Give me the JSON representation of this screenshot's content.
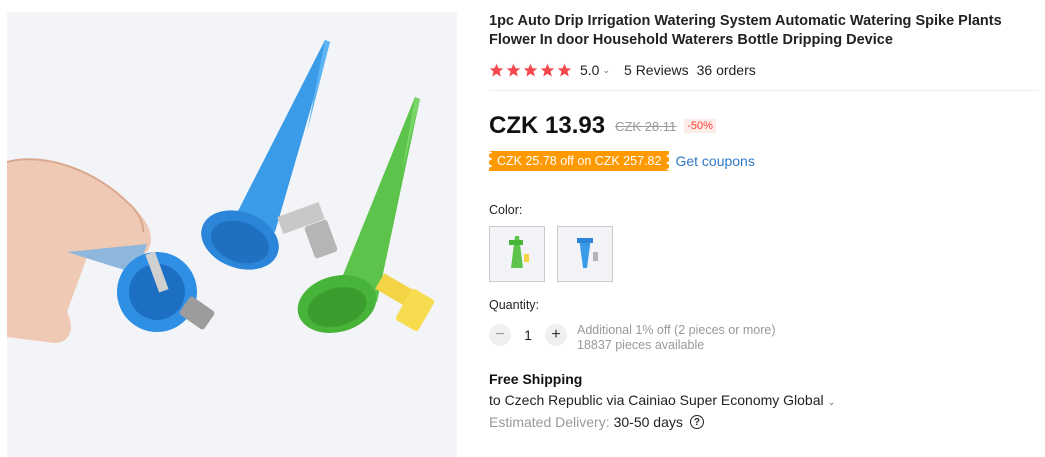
{
  "product": {
    "title": "1pc Auto Drip Irrigation Watering System Automatic Watering Spike Plants Flower In door Household Waterers Bottle Dripping Device",
    "rating": {
      "stars": 5,
      "score": "5.0",
      "reviews": "5 Reviews",
      "orders": "36 orders"
    },
    "price": {
      "current": "CZK 13.93",
      "original": "CZK 28.11",
      "discount": "-50%"
    },
    "coupon": {
      "text": "CZK 25.78 off on CZK 257.82",
      "link": "Get coupons"
    },
    "color": {
      "label": "Color:",
      "options": [
        "green-spike",
        "blue-spike"
      ]
    },
    "quantity": {
      "label": "Quantity:",
      "value": "1",
      "minus": "−",
      "plus": "+",
      "additional": "Additional 1% off (2 pieces or more)",
      "available": "18837 pieces available"
    },
    "shipping": {
      "title": "Free Shipping",
      "to": "to Czech Republic via Cainiao Super Economy Global",
      "delivery_label": "Estimated Delivery:",
      "delivery_days": "30-50 days"
    }
  },
  "colors": {
    "star": "#f5474d",
    "coupon_bg": "#ff9900",
    "link": "#2e78c4",
    "discount": "#ff3b30"
  },
  "icons": [
    "star-icon",
    "chevron-down-icon",
    "minus-icon",
    "plus-icon",
    "help-circle-icon"
  ]
}
